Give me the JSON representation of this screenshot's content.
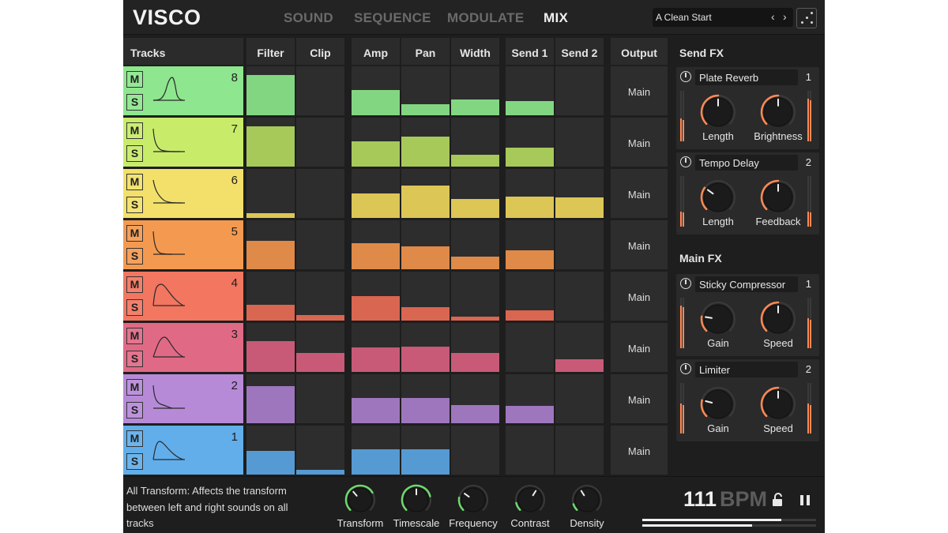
{
  "app": {
    "logo": "VISCO",
    "nav": [
      {
        "label": "SOUND",
        "active": false
      },
      {
        "label": "SEQUENCE",
        "active": false
      },
      {
        "label": "MODULATE",
        "active": false
      },
      {
        "label": "MIX",
        "active": true
      }
    ],
    "preset": {
      "name": "A Clean Start",
      "prev_icon": "chevron-left-icon",
      "next_icon": "chevron-right-icon"
    },
    "dice_icon": "dice-icon"
  },
  "tracks": {
    "title": "Tracks",
    "mute_label": "M",
    "solo_label": "S",
    "rows": [
      {
        "number": "8",
        "color": "#8ee68e"
      },
      {
        "number": "7",
        "color": "#c8ec6a"
      },
      {
        "number": "6",
        "color": "#f2e06a"
      },
      {
        "number": "5",
        "color": "#f49a50"
      },
      {
        "number": "4",
        "color": "#f27660"
      },
      {
        "number": "3",
        "color": "#e06a86"
      },
      {
        "number": "2",
        "color": "#b78ad8"
      },
      {
        "number": "1",
        "color": "#62aeea"
      }
    ]
  },
  "mixer": {
    "columns": [
      "Filter",
      "Clip",
      "Amp",
      "Pan",
      "Width",
      "Send 1",
      "Send 2"
    ],
    "output_header": "Output",
    "output_values": [
      "Main",
      "Main",
      "Main",
      "Main",
      "Main",
      "Main",
      "Main",
      "Main"
    ],
    "fill_colors": [
      "#82d682",
      "#a6c95a",
      "#dcc656",
      "#df8a48",
      "#d96650",
      "#c85a77",
      "#9e76bd",
      "#569ad3"
    ],
    "levels": [
      [
        0.82,
        0,
        0.52,
        0.23,
        0.33,
        0.29,
        0
      ],
      [
        0.82,
        0,
        0.52,
        0.62,
        0.25,
        0.38,
        0
      ],
      [
        0.09,
        0,
        0.5,
        0.66,
        0.39,
        0.43,
        0.42
      ],
      [
        0.58,
        0,
        0.53,
        0.46,
        0.26,
        0.38,
        0
      ],
      [
        0.32,
        0.11,
        0.5,
        0.27,
        0.08,
        0.21,
        0
      ],
      [
        0.63,
        0.38,
        0.5,
        0.51,
        0.38,
        0,
        0.26
      ],
      [
        0.76,
        0,
        0.51,
        0.51,
        0.37,
        0.35,
        0
      ],
      [
        0.48,
        0.1,
        0.52,
        0.52,
        0,
        0,
        0
      ]
    ]
  },
  "send_fx": {
    "title": "Send FX",
    "units": [
      {
        "name": "Plate Reverb",
        "slot": "1",
        "knobs": [
          {
            "label": "Length",
            "value": 0.5
          },
          {
            "label": "Brightness",
            "value": 0.5
          }
        ],
        "meters": [
          0.45,
          0.85
        ]
      },
      {
        "name": "Tempo Delay",
        "slot": "2",
        "knobs": [
          {
            "label": "Length",
            "value": 0.3
          },
          {
            "label": "Feedback",
            "value": 0.5
          }
        ],
        "meters": [
          0.3,
          0.3
        ]
      }
    ]
  },
  "main_fx": {
    "title": "Main FX",
    "units": [
      {
        "name": "Sticky Compressor",
        "slot": "1",
        "knobs": [
          {
            "label": "Gain",
            "value": 0.2
          },
          {
            "label": "Speed",
            "value": 0.5
          }
        ],
        "meters": [
          0.85,
          0.6
        ]
      },
      {
        "name": "Limiter",
        "slot": "2",
        "knobs": [
          {
            "label": "Gain",
            "value": 0.22
          },
          {
            "label": "Speed",
            "value": 0.5
          }
        ],
        "meters": [
          0.6,
          0.6
        ]
      }
    ]
  },
  "bottom": {
    "info": "All Transform: Affects the transform between left and right sounds on all tracks",
    "knobs": [
      {
        "label": "Transform",
        "value": 0.35,
        "ring": 0.72
      },
      {
        "label": "Timescale",
        "value": 0.5,
        "ring": 0.78
      },
      {
        "label": "Frequency",
        "value": 0.3,
        "ring": 0.2
      },
      {
        "label": "Contrast",
        "value": 0.62,
        "ring": 0.12
      },
      {
        "label": "Density",
        "value": 0.38,
        "ring": 0.1
      }
    ],
    "bpm_value": "111",
    "bpm_unit": "BPM",
    "lock_icon": "lock-open-icon",
    "pause_icon": "pause-icon",
    "progress": [
      0.8,
      0.63
    ]
  },
  "colors": {
    "accent_orange": "#ff8a55",
    "accent_green": "#6fd86f",
    "background": "#1e1e1e",
    "cell": "#2d2d2d"
  }
}
